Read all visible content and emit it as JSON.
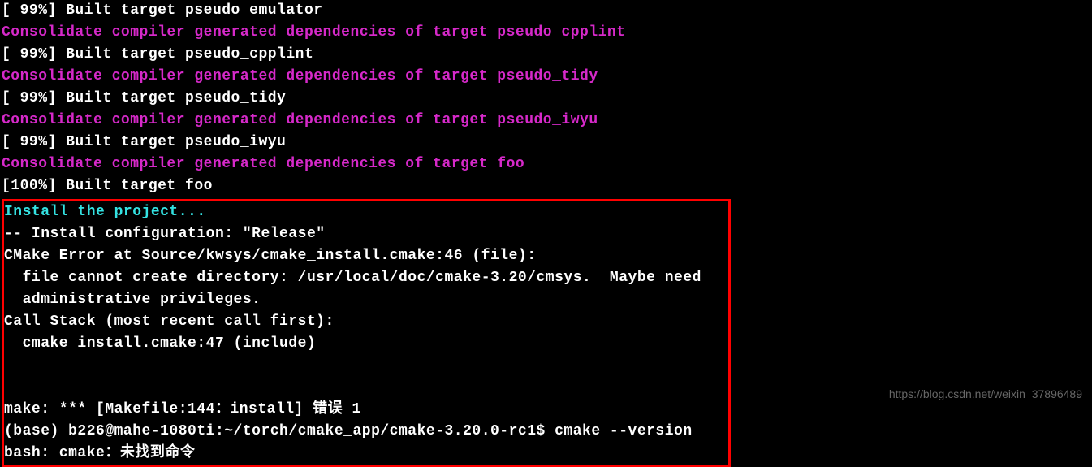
{
  "terminal": {
    "lines": [
      {
        "cls": "white",
        "text": "[ 99%] Built target pseudo_emulator"
      },
      {
        "cls": "magenta",
        "text": "Consolidate compiler generated dependencies of target pseudo_cpplint"
      },
      {
        "cls": "white",
        "text": "[ 99%] Built target pseudo_cpplint"
      },
      {
        "cls": "magenta",
        "text": "Consolidate compiler generated dependencies of target pseudo_tidy"
      },
      {
        "cls": "white",
        "text": "[ 99%] Built target pseudo_tidy"
      },
      {
        "cls": "magenta",
        "text": "Consolidate compiler generated dependencies of target pseudo_iwyu"
      },
      {
        "cls": "white",
        "text": "[ 99%] Built target pseudo_iwyu"
      },
      {
        "cls": "magenta",
        "text": "Consolidate compiler generated dependencies of target foo"
      },
      {
        "cls": "white",
        "text": "[100%] Built target foo"
      }
    ],
    "boxed_lines": [
      {
        "cls": "cyan",
        "text": "Install the project..."
      },
      {
        "cls": "white",
        "text": "-- Install configuration: \"Release\""
      },
      {
        "cls": "white",
        "text": "CMake Error at Source/kwsys/cmake_install.cmake:46 (file):"
      },
      {
        "cls": "white",
        "text": "  file cannot create directory: /usr/local/doc/cmake-3.20/cmsys.  Maybe need"
      },
      {
        "cls": "white",
        "text": "  administrative privileges."
      },
      {
        "cls": "white",
        "text": "Call Stack (most recent call first):"
      },
      {
        "cls": "white",
        "text": "  cmake_install.cmake:47 (include)"
      },
      {
        "cls": "white",
        "text": ""
      },
      {
        "cls": "white",
        "text": ""
      },
      {
        "cls": "white",
        "text": "make: *** [Makefile:144：install] 错误 1"
      },
      {
        "cls": "white",
        "text": "(base) b226@mahe-1080ti:~/torch/cmake_app/cmake-3.20.0-rc1$ cmake --version"
      },
      {
        "cls": "white",
        "text": "bash: cmake：未找到命令"
      }
    ]
  },
  "watermark": "https://blog.csdn.net/weixin_37896489"
}
